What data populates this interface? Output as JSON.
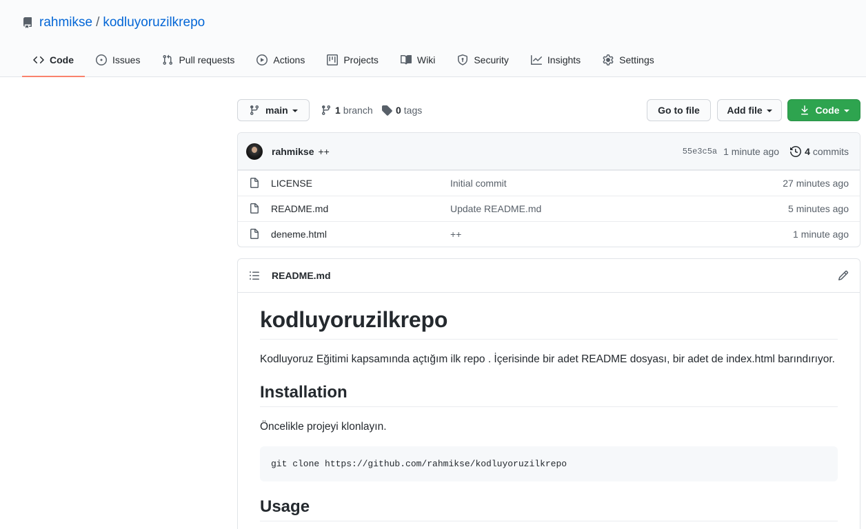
{
  "repo": {
    "owner": "rahmikse",
    "separator": "/",
    "name": "kodluyoruzilkrepo"
  },
  "tabs": [
    {
      "label": "Code",
      "icon": "code-icon",
      "selected": true
    },
    {
      "label": "Issues",
      "icon": "issue-icon"
    },
    {
      "label": "Pull requests",
      "icon": "pull-request-icon"
    },
    {
      "label": "Actions",
      "icon": "play-icon"
    },
    {
      "label": "Projects",
      "icon": "project-icon"
    },
    {
      "label": "Wiki",
      "icon": "book-icon"
    },
    {
      "label": "Security",
      "icon": "shield-icon"
    },
    {
      "label": "Insights",
      "icon": "graph-icon"
    },
    {
      "label": "Settings",
      "icon": "gear-icon"
    }
  ],
  "toolbar": {
    "branch_name": "main",
    "branch_count": "1",
    "branch_label": "branch",
    "tag_count": "0",
    "tag_label": "tags",
    "go_to_file": "Go to file",
    "add_file": "Add file",
    "code": "Code"
  },
  "latest_commit": {
    "author": "rahmikse",
    "message": "++",
    "sha": "55e3c5a",
    "time": "1 minute ago",
    "commit_count": "4",
    "commit_label": "commits"
  },
  "files": [
    {
      "name": "LICENSE",
      "message": "Initial commit",
      "age": "27 minutes ago",
      "icon": "file-icon"
    },
    {
      "name": "README.md",
      "message": "Update README.md",
      "age": "5 minutes ago",
      "icon": "file-icon"
    },
    {
      "name": "deneme.html",
      "message": "++",
      "age": "1 minute ago",
      "icon": "file-icon"
    }
  ],
  "readme": {
    "file_title": "README.md",
    "h1": "kodluyoruzilkrepo",
    "intro": "Kodluyoruz Eğitimi kapsamında açtığım ilk repo . İçerisinde bir adet README dosyası, bir adet de index.html barındırıyor.",
    "installation_heading": "Installation",
    "installation_text": "Öncelikle projeyi klonlayın.",
    "clone_command": "git clone https://github.com/rahmikse/kodluyoruzilkrepo",
    "usage_heading": "Usage"
  },
  "colors": {
    "link": "#0366d6",
    "tab_underline": "#f9826c",
    "primary_button": "#2ea44f"
  }
}
